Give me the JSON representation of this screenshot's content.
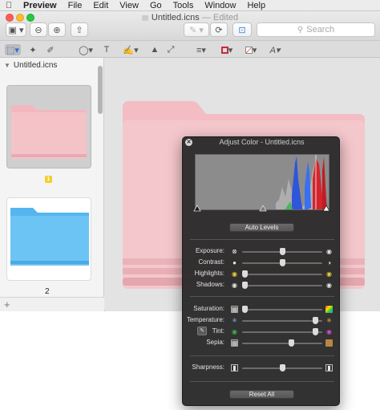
{
  "menubar": {
    "apple": "",
    "items": [
      "Preview",
      "File",
      "Edit",
      "View",
      "Go",
      "Tools",
      "Window",
      "Help"
    ]
  },
  "window": {
    "title": "Untitled.icns",
    "status": "— Edited",
    "toolbar": {
      "sidebar_btn": "▣ ▾",
      "zoom_out": "⊖",
      "zoom_in": "⊕",
      "share": "⇧",
      "markup_pen": "✎ ▾",
      "rotate": "⟳",
      "toolbox": "⊡"
    },
    "search": {
      "placeholder": "Search",
      "icon": "search-icon"
    }
  },
  "markup": {
    "tools": [
      "rect-select",
      "instant-alpha",
      "sketch",
      "shapes",
      "text",
      "sign",
      "adjust-color",
      "adjust-size",
      "shape-style",
      "border-color",
      "fill-color",
      "text-style"
    ]
  },
  "sidebar": {
    "header": "Untitled.icns",
    "thumbs": [
      {
        "page": "1",
        "color": "#f4c3c8",
        "tab_color": "#f2b8be"
      },
      {
        "page": "2",
        "color": "#6cc4f4",
        "tab_color": "#55b6ef"
      }
    ],
    "add": "+"
  },
  "canvas": {
    "folder_color": "#f4c7cc",
    "folder_shadow": "#e7aeb5"
  },
  "adjust": {
    "title": "Adjust Color - Untitled.icns",
    "auto_levels": "Auto Levels",
    "reset_all": "Reset All",
    "histogram": {
      "colors": {
        "background": "#8c8c8c",
        "blue": "#2e56d8",
        "red": "#d6242c",
        "green": "#3cb24a",
        "gray": "#b7b7b7"
      }
    },
    "sliders": [
      {
        "label": "Exposure:",
        "value": 0.5
      },
      {
        "label": "Contrast:",
        "value": 0.5
      },
      {
        "label": "Highlights:",
        "value": 0.0
      },
      {
        "label": "Shadows:",
        "value": 0.0
      },
      {
        "label": "Saturation:",
        "value": 0.0
      },
      {
        "label": "Temperature:",
        "value": 0.95
      },
      {
        "label": "Tint:",
        "value": 0.95
      },
      {
        "label": "Sepia:",
        "value": 0.62
      },
      {
        "label": "Sharpness:",
        "value": 0.5
      }
    ]
  }
}
